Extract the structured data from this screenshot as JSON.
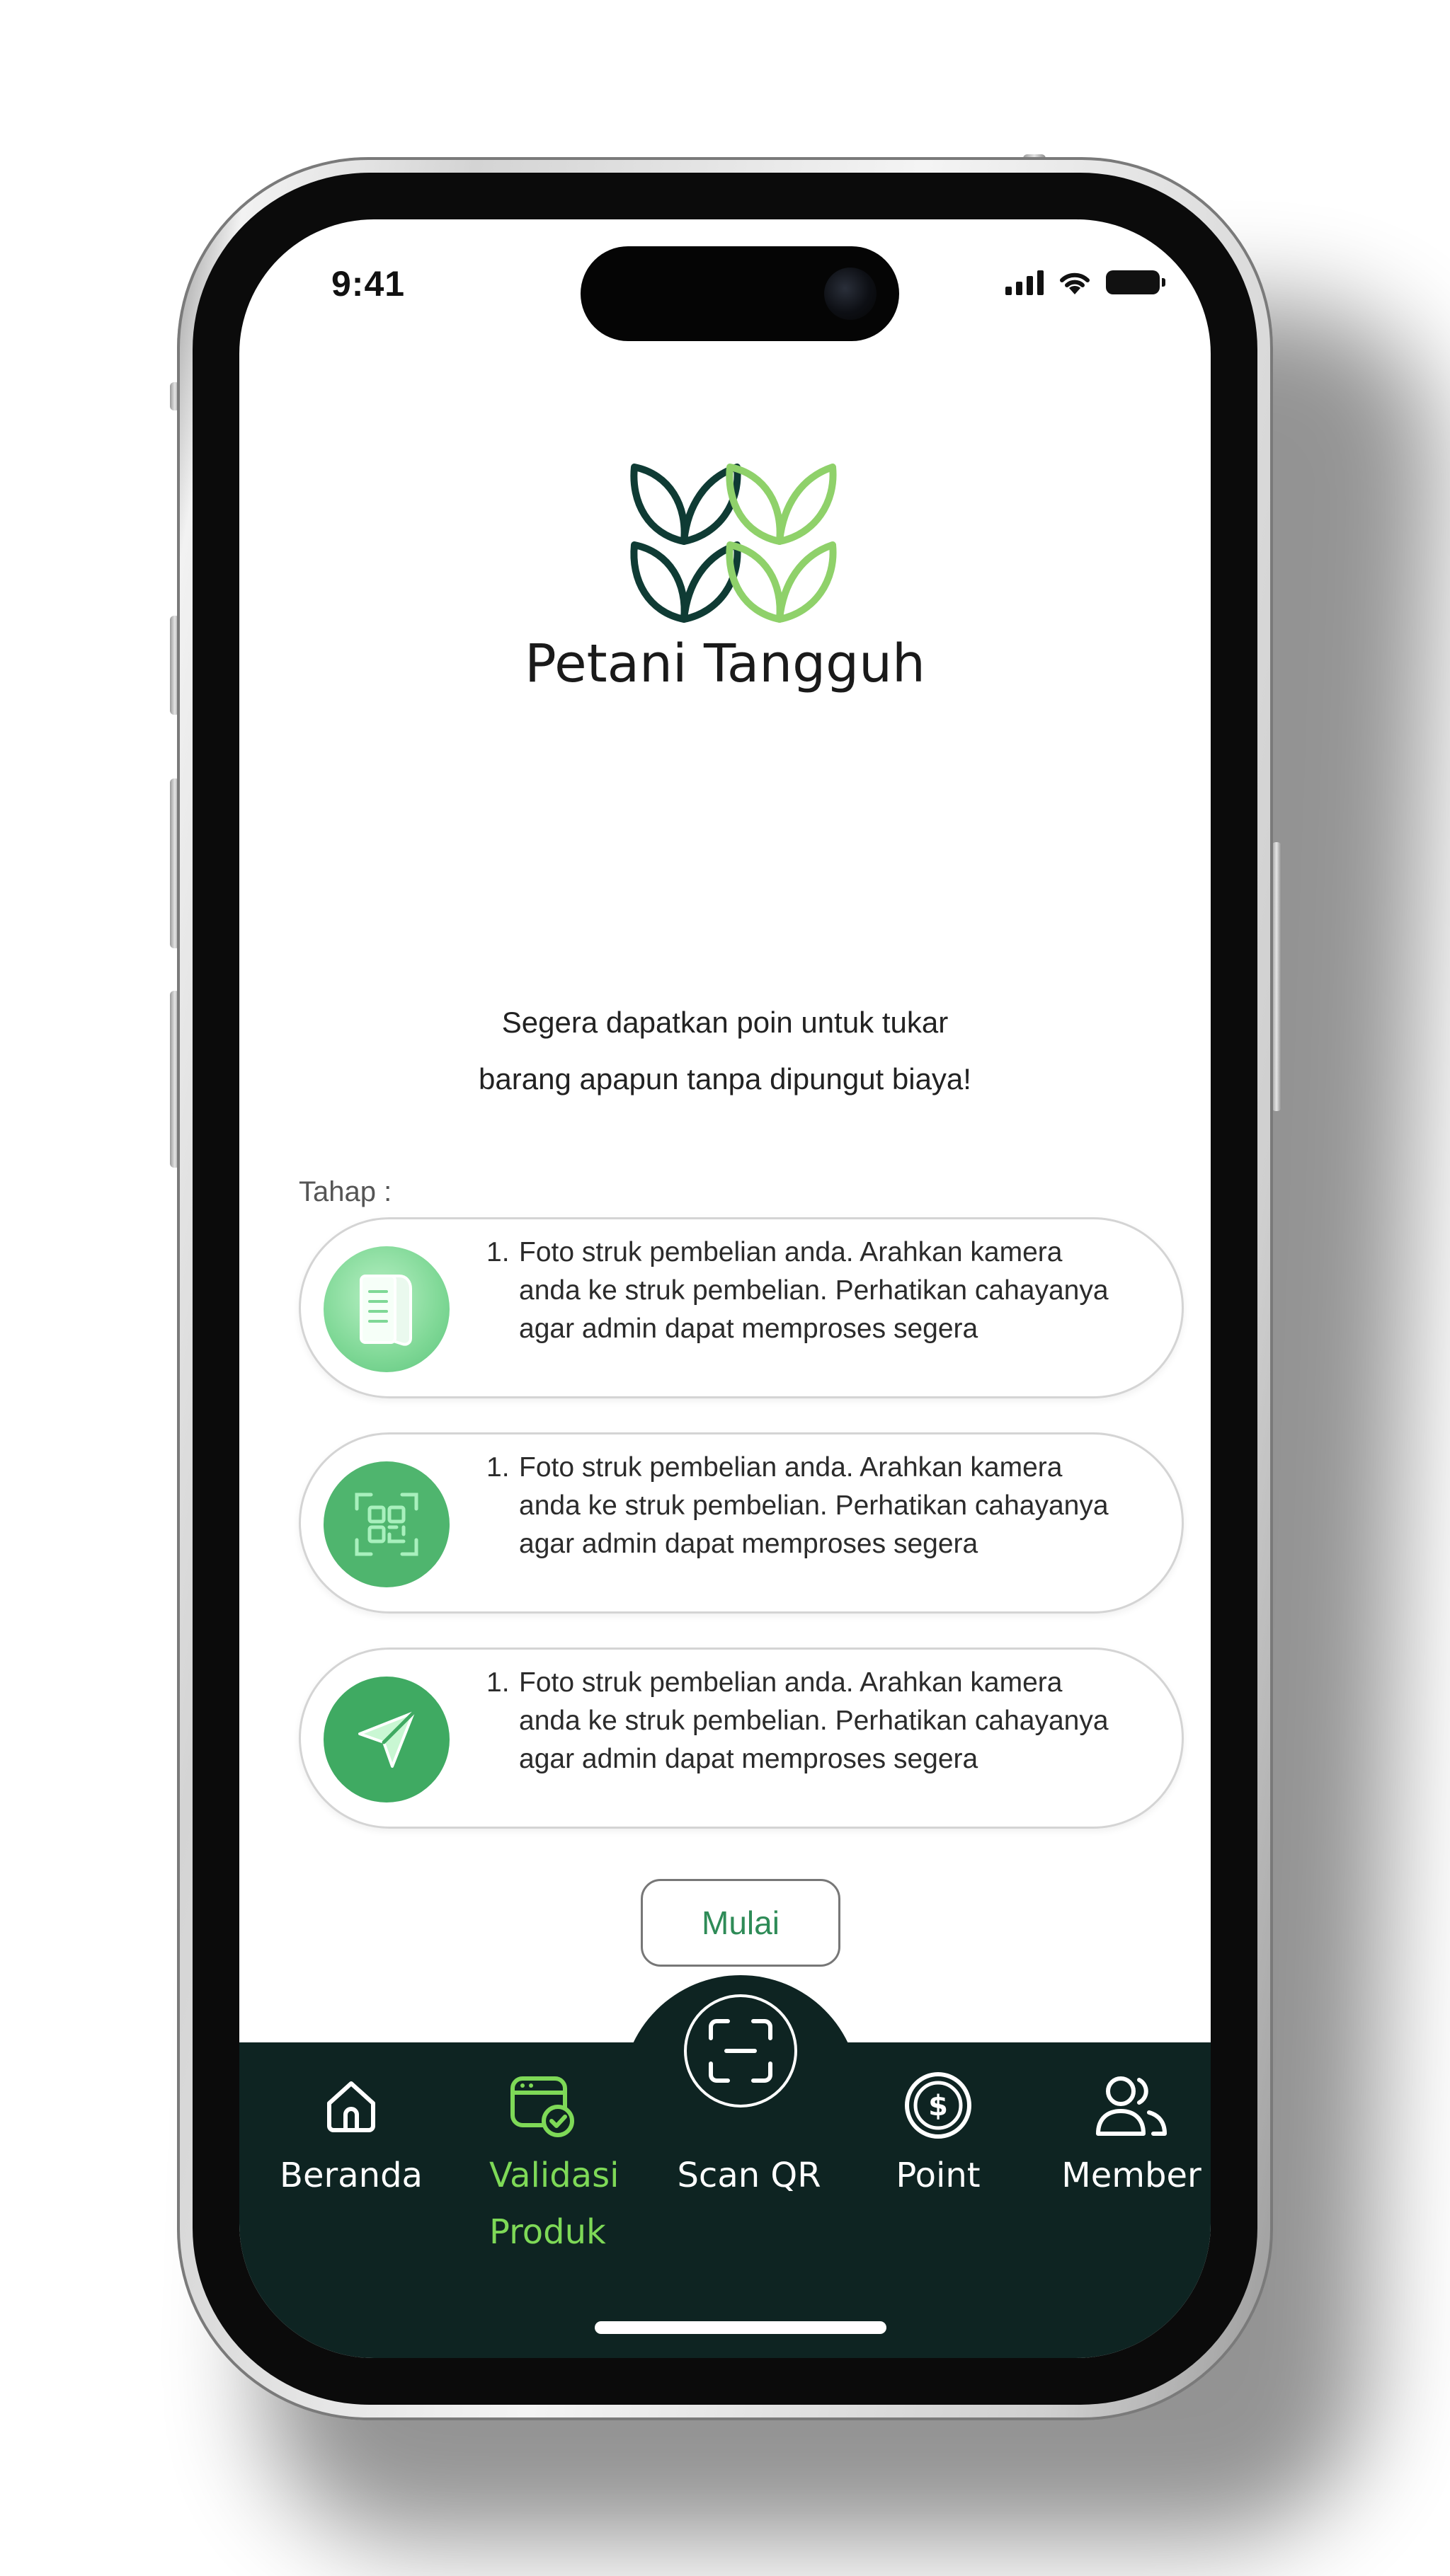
{
  "status_bar": {
    "time": "9:41"
  },
  "brand": {
    "name": "Petani Tangguh"
  },
  "intro": {
    "line1": "Segera dapatkan poin untuk tukar",
    "line2": "barang apapun tanpa dipungut biaya!"
  },
  "steps_label": "Tahap :",
  "steps": [
    {
      "number": "1.",
      "text": "Foto struk pembelian anda. Arahkan kamera anda ke struk pembelian. Perhatikan cahayanya agar admin dapat memproses segera",
      "icon": "receipt-icon"
    },
    {
      "number": "1.",
      "text": "Foto struk pembelian anda. Arahkan kamera anda ke struk pembelian. Perhatikan cahayanya agar admin dapat memproses segera",
      "icon": "qr-code-icon"
    },
    {
      "number": "1.",
      "text": "Foto struk pembelian anda. Arahkan kamera anda ke struk pembelian. Perhatikan cahayanya agar admin dapat memproses segera",
      "icon": "send-icon"
    }
  ],
  "start_button": "Mulai",
  "nav": {
    "items": [
      {
        "label": "Beranda",
        "icon": "home-icon",
        "active": false
      },
      {
        "label": "Validasi Produk",
        "icon": "validate-icon",
        "active": true
      },
      {
        "label": "Scan QR",
        "icon": "scan-icon",
        "active": false
      },
      {
        "label": "Point",
        "icon": "dollar-coin-icon",
        "active": false
      },
      {
        "label": "Member",
        "icon": "users-icon",
        "active": false
      }
    ]
  },
  "colors": {
    "nav_bg": "#0e2422",
    "accent_green": "#7ed957",
    "dark_green": "#0f3b34",
    "light_green": "#8fd16a"
  }
}
